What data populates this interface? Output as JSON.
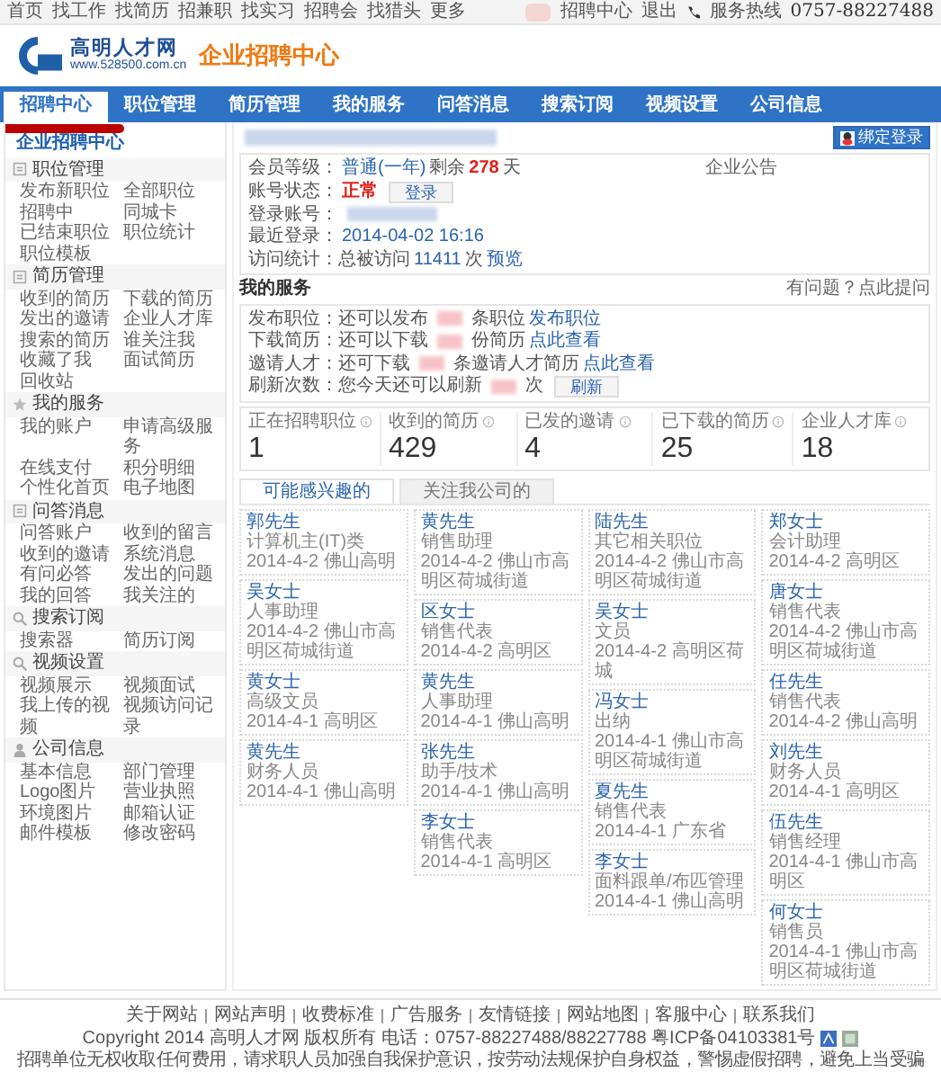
{
  "topbar": {
    "links": [
      "首页",
      "找工作",
      "找简历",
      "招兼职",
      "找实习",
      "招聘会",
      "找猎头",
      "更多"
    ],
    "right_links": [
      "招聘中心",
      "退出"
    ],
    "hotline_label": "服务热线",
    "hotline": "0757-88227488"
  },
  "logo": {
    "name": "高明人才网",
    "url": "www.528500.com.cn",
    "title": "企业招聘中心"
  },
  "nav": [
    {
      "label": "招聘中心",
      "selected": true
    },
    {
      "label": "职位管理",
      "selected": false
    },
    {
      "label": "简历管理",
      "selected": false
    },
    {
      "label": "我的服务",
      "selected": false
    },
    {
      "label": "问答消息",
      "selected": false
    },
    {
      "label": "搜索订阅",
      "selected": false
    },
    {
      "label": "视频设置",
      "selected": false
    },
    {
      "label": "公司信息",
      "selected": false
    }
  ],
  "sidebar": {
    "title": "企业招聘中心",
    "sections": [
      {
        "title": "职位管理",
        "links": [
          "发布新职位",
          "全部职位",
          "招聘中",
          "同城卡",
          "已结束职位",
          "职位统计",
          "职位模板"
        ]
      },
      {
        "title": "简历管理",
        "links": [
          "收到的简历",
          "下载的简历",
          "发出的邀请",
          "企业人才库",
          "搜索的简历",
          "谁关注我",
          "收藏了我",
          "面试简历",
          "回收站"
        ]
      },
      {
        "title": "我的服务",
        "links": [
          "我的账户",
          "申请高级服务",
          "在线支付",
          "积分明细",
          "个性化首页",
          "电子地图"
        ]
      },
      {
        "title": "问答消息",
        "links": [
          "问答账户",
          "收到的留言",
          "收到的邀请",
          "系统消息",
          "有问必答",
          "发出的问题",
          "我的回答",
          "我关注的"
        ]
      },
      {
        "title": "搜索订阅",
        "links": [
          "搜索器",
          "简历订阅"
        ]
      },
      {
        "title": "视频设置",
        "links": [
          "视频展示",
          "视频面试",
          "我上传的视频",
          "视频访问记录"
        ]
      },
      {
        "title": "公司信息",
        "links": [
          "基本信息",
          "部门管理",
          "Logo图片",
          "营业执照",
          "环境图片",
          "邮箱认证",
          "邮件模板",
          "修改密码"
        ]
      }
    ]
  },
  "account": {
    "bind_button": "绑定登录",
    "notice_title": "企业公告",
    "lines": [
      {
        "parts": [
          {
            "kind": "label",
            "text": "会员等级："
          },
          {
            "kind": "link",
            "text": "普通(一年)"
          },
          {
            "kind": "label",
            "text": "剩余"
          },
          {
            "kind": "alert",
            "text": "278"
          },
          {
            "kind": "label",
            "text": "天"
          }
        ]
      },
      {
        "parts": [
          {
            "kind": "label",
            "text": "账号状态："
          },
          {
            "kind": "alert",
            "text": "正常"
          },
          {
            "kind": "button",
            "text": "登录"
          }
        ]
      },
      {
        "parts": [
          {
            "kind": "label",
            "text": "登录账号："
          },
          {
            "kind": "redacted"
          }
        ]
      },
      {
        "parts": [
          {
            "kind": "label",
            "text": "最近登录："
          },
          {
            "kind": "link",
            "text": "2014-04-02 16:16"
          }
        ]
      },
      {
        "parts": [
          {
            "kind": "label",
            "text": "访问统计：总被访问"
          },
          {
            "kind": "link",
            "text": "11411"
          },
          {
            "kind": "label",
            "text": "次"
          },
          {
            "kind": "link",
            "text": "预览"
          }
        ]
      }
    ]
  },
  "services": {
    "title": "我的服务",
    "help_link": "有问题？点此提问",
    "lines": [
      {
        "parts": [
          {
            "kind": "label",
            "text": "发布职位：还可以发布"
          },
          {
            "kind": "redacted"
          },
          {
            "kind": "label",
            "text": "条职位"
          },
          {
            "kind": "link",
            "text": "发布职位"
          }
        ]
      },
      {
        "parts": [
          {
            "kind": "label",
            "text": "下载简历：还可以下载"
          },
          {
            "kind": "redacted"
          },
          {
            "kind": "label",
            "text": "份简历"
          },
          {
            "kind": "link",
            "text": "点此查看"
          }
        ]
      },
      {
        "parts": [
          {
            "kind": "label",
            "text": "邀请人才：还可下载"
          },
          {
            "kind": "redacted"
          },
          {
            "kind": "label",
            "text": "条邀请人才简历"
          },
          {
            "kind": "link",
            "text": "点此查看"
          }
        ]
      },
      {
        "parts": [
          {
            "kind": "label",
            "text": "刷新次数：您今天还可以刷新"
          },
          {
            "kind": "redacted"
          },
          {
            "kind": "label",
            "text": "次"
          },
          {
            "kind": "button",
            "text": "刷新"
          }
        ]
      }
    ]
  },
  "stats": [
    {
      "label": "正在招聘职位",
      "value": "1"
    },
    {
      "label": "收到的简历",
      "value": "429"
    },
    {
      "label": "已发的邀请",
      "value": "4"
    },
    {
      "label": "已下载的简历",
      "value": "25"
    },
    {
      "label": "企业人才库",
      "value": "18"
    }
  ],
  "tabs": [
    {
      "label": "可能感兴趣的",
      "selected": true
    },
    {
      "label": "关注我公司的",
      "selected": false
    }
  ],
  "candidate_columns": [
    [
      {
        "name": "郭先生",
        "job": "计算机主(IT)类",
        "meta": "2014-4-2 佛山高明"
      },
      {
        "name": "吴女士",
        "job": "人事助理",
        "meta": "2014-4-2 佛山市高明区荷城街道"
      },
      {
        "name": "黄女士",
        "job": "高级文员",
        "meta": "2014-4-1 高明区"
      },
      {
        "name": "黄先生",
        "job": "财务人员",
        "meta": "2014-4-1 佛山高明"
      }
    ],
    [
      {
        "name": "黄先生",
        "job": "销售助理",
        "meta": "2014-4-2 佛山市高明区荷城街道"
      },
      {
        "name": "区女士",
        "job": "销售代表",
        "meta": "2014-4-2 高明区"
      },
      {
        "name": "黄先生",
        "job": "人事助理",
        "meta": "2014-4-1 佛山高明"
      },
      {
        "name": "张先生",
        "job": "助手/技术",
        "meta": "2014-4-1 佛山高明"
      },
      {
        "name": "李女士",
        "job": "销售代表",
        "meta": "2014-4-1 高明区"
      }
    ],
    [
      {
        "name": "陆先生",
        "job": "其它相关职位",
        "meta": "2014-4-2 佛山市高明区荷城街道"
      },
      {
        "name": "吴女士",
        "job": "文员",
        "meta": "2014-4-2 高明区荷城"
      },
      {
        "name": "冯女士",
        "job": "出纳",
        "meta": "2014-4-1 佛山市高明区荷城街道"
      },
      {
        "name": "夏先生",
        "job": "销售代表",
        "meta": "2014-4-1 广东省"
      },
      {
        "name": "李女士",
        "job": "面料跟单/布匹管理",
        "meta": "2014-4-1 佛山高明"
      }
    ],
    [
      {
        "name": "郑女士",
        "job": "会计助理",
        "meta": "2014-4-2 高明区"
      },
      {
        "name": "唐女士",
        "job": "销售代表",
        "meta": "2014-4-2 佛山市高明区荷城街道"
      },
      {
        "name": "任先生",
        "job": "销售代表",
        "meta": "2014-4-2 佛山高明"
      },
      {
        "name": "刘先生",
        "job": "财务人员",
        "meta": "2014-4-1 高明区"
      },
      {
        "name": "伍先生",
        "job": "销售经理",
        "meta": "2014-4-1 佛山市高明区"
      },
      {
        "name": "何女士",
        "job": "销售员",
        "meta": "2014-4-1 佛山市高明区荷城街道"
      }
    ]
  ],
  "footer": {
    "links": [
      "关于网站",
      "网站声明",
      "收费标准",
      "广告服务",
      "友情链接",
      "网站地图",
      "客服中心",
      "联系我们"
    ],
    "copyright": "Copyright 2014 高明人才网 版权所有 电话：0757-88227488/88227788 粤ICP备04103381号",
    "notice": "招聘单位无权收取任何费用，请求职人员加强自我保护意识，按劳动法规保护自身权益，警惕虚假招聘，避免上当受骗"
  }
}
